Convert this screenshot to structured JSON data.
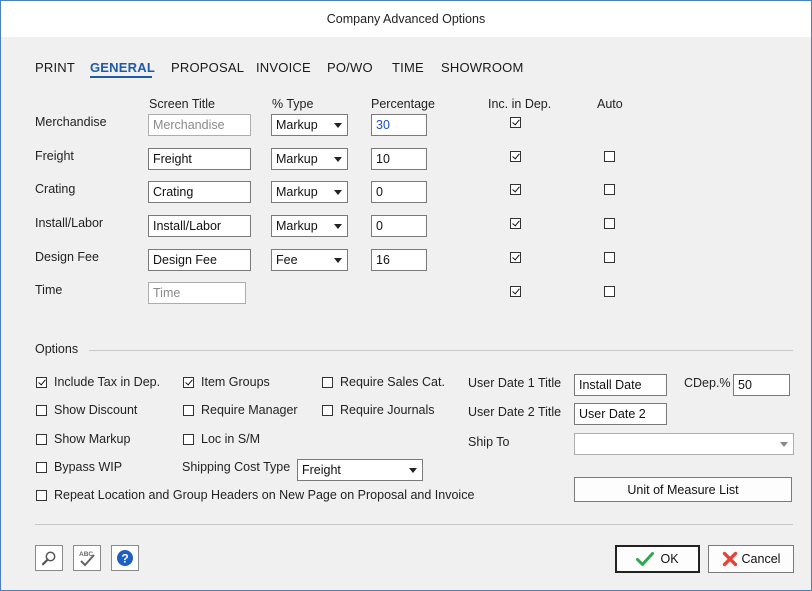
{
  "window": {
    "title": "Company Advanced Options"
  },
  "tabs": [
    {
      "label": "PRINT",
      "active": false
    },
    {
      "label": "GENERAL",
      "active": true
    },
    {
      "label": "PROPOSAL",
      "active": false
    },
    {
      "label": "INVOICE",
      "active": false
    },
    {
      "label": "PO/WO",
      "active": false
    },
    {
      "label": "TIME",
      "active": false
    },
    {
      "label": "SHOWROOM",
      "active": false
    }
  ],
  "grid": {
    "headers": {
      "screen_title": "Screen Title",
      "type": "% Type",
      "percentage": "Percentage",
      "inc_dep": "Inc. in Dep.",
      "auto": "Auto"
    },
    "rows": [
      {
        "label": "Merchandise",
        "screen_title": "Merchandise",
        "type": "Markup",
        "percentage": "30",
        "inc_dep": true,
        "auto": null
      },
      {
        "label": "Freight",
        "screen_title": "Freight",
        "type": "Markup",
        "percentage": "10",
        "inc_dep": true,
        "auto": false
      },
      {
        "label": "Crating",
        "screen_title": "Crating",
        "type": "Markup",
        "percentage": "0",
        "inc_dep": true,
        "auto": false
      },
      {
        "label": "Install/Labor",
        "screen_title": "Install/Labor",
        "type": "Markup",
        "percentage": "0",
        "inc_dep": true,
        "auto": false
      },
      {
        "label": "Design Fee",
        "screen_title": "Design Fee",
        "type": "Fee",
        "percentage": "16",
        "inc_dep": true,
        "auto": false
      },
      {
        "label": "Time",
        "screen_title": "Time",
        "type": null,
        "percentage": null,
        "inc_dep": true,
        "auto": false
      }
    ]
  },
  "options": {
    "section_label": "Options",
    "include_tax": {
      "label": "Include Tax in Dep.",
      "checked": true
    },
    "show_discount": {
      "label": "Show Discount",
      "checked": false
    },
    "show_markup": {
      "label": "Show Markup",
      "checked": false
    },
    "bypass_wip": {
      "label": "Bypass WIP",
      "checked": false
    },
    "item_groups": {
      "label": "Item Groups",
      "checked": true
    },
    "require_manager": {
      "label": "Require Manager",
      "checked": false
    },
    "loc_in_sm": {
      "label": "Loc in S/M",
      "checked": false
    },
    "require_sales_cat": {
      "label": "Require Sales Cat.",
      "checked": false
    },
    "require_journals": {
      "label": "Require Journals",
      "checked": false
    },
    "shipping_cost_type": {
      "label": "Shipping Cost Type",
      "value": "Freight"
    },
    "repeat_headers": {
      "label": "Repeat Location and Group Headers on New Page on Proposal and Invoice",
      "checked": false
    },
    "user_date_1": {
      "label": "User Date 1 Title",
      "value": "Install Date"
    },
    "user_date_2": {
      "label": "User Date 2 Title",
      "value": "User Date 2"
    },
    "cdep": {
      "label": "CDep.%",
      "value": "50"
    },
    "ship_to": {
      "label": "Ship To",
      "value": ""
    },
    "uom_button": "Unit of Measure List"
  },
  "footer": {
    "ok": "OK",
    "cancel": "Cancel",
    "icons": [
      "search-icon",
      "spellcheck-icon",
      "help-icon"
    ]
  }
}
